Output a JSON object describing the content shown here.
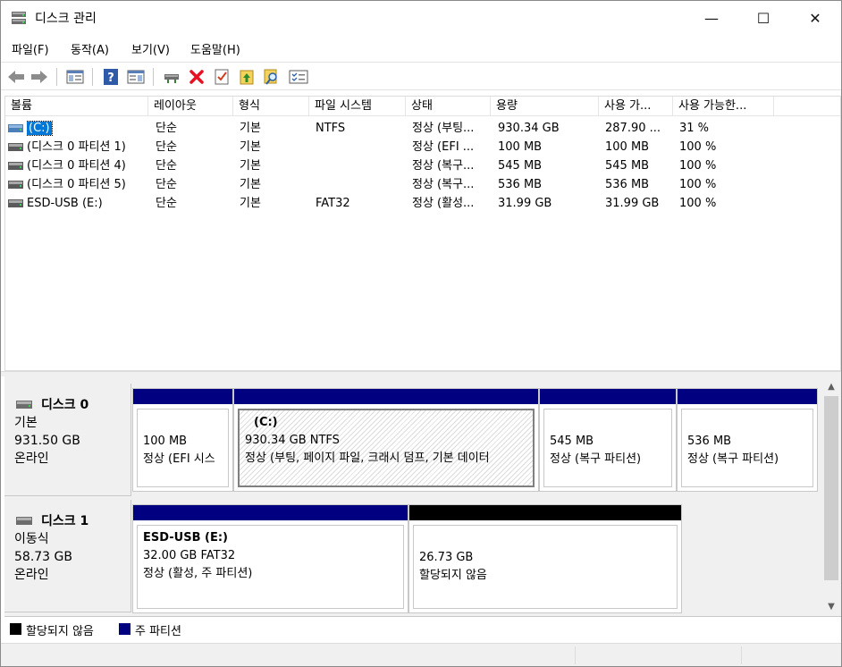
{
  "window": {
    "title": "디스크 관리",
    "controls": {
      "minimize": "—",
      "maximize": "☐",
      "close": "✕"
    }
  },
  "menu": [
    "파일(F)",
    "동작(A)",
    "보기(V)",
    "도움말(H)"
  ],
  "toolbar": {
    "icons": [
      "back-icon",
      "forward-icon",
      "show-hide-console-tree-icon",
      "help-icon",
      "show-hide-action-pane-icon",
      "connect-drive-icon",
      "delete-icon",
      "properties-icon",
      "import-icon",
      "search-icon",
      "rescan-icon"
    ],
    "colors": {
      "delete": "#e81123",
      "arrow": "#8c8c8c"
    }
  },
  "volume_list": {
    "columns": [
      "볼륨",
      "레이아웃",
      "형식",
      "파일 시스템",
      "상태",
      "용량",
      "사용 가...",
      "사용 가능한..."
    ],
    "rows": [
      {
        "volume": "(C:)",
        "layout": "단순",
        "type": "기본",
        "fs": "NTFS",
        "status": "정상 (부팅...",
        "capacity": "930.34 GB",
        "free": "287.90 ...",
        "pct": "31 %",
        "selected": true
      },
      {
        "volume": "(디스크 0 파티션 1)",
        "layout": "단순",
        "type": "기본",
        "fs": "",
        "status": "정상 (EFI ...",
        "capacity": "100 MB",
        "free": "100 MB",
        "pct": "100 %",
        "selected": false
      },
      {
        "volume": "(디스크 0 파티션 4)",
        "layout": "단순",
        "type": "기본",
        "fs": "",
        "status": "정상 (복구...",
        "capacity": "545 MB",
        "free": "545 MB",
        "pct": "100 %",
        "selected": false
      },
      {
        "volume": "(디스크 0 파티션 5)",
        "layout": "단순",
        "type": "기본",
        "fs": "",
        "status": "정상 (복구...",
        "capacity": "536 MB",
        "free": "536 MB",
        "pct": "100 %",
        "selected": false
      },
      {
        "volume": "ESD-USB (E:)",
        "layout": "단순",
        "type": "기본",
        "fs": "FAT32",
        "status": "정상 (활성...",
        "capacity": "31.99 GB",
        "free": "31.99 GB",
        "pct": "100 %",
        "selected": false
      }
    ]
  },
  "disks": [
    {
      "name": "디스크 0",
      "kind": "기본",
      "size": "931.50 GB",
      "state": "온라인",
      "partitions": [
        {
          "title": "",
          "line1": "100 MB",
          "line2": "정상 (EFI 시스",
          "bar": "primary"
        },
        {
          "title": "(C:)",
          "line1": "930.34 GB NTFS",
          "line2": "정상 (부팅, 페이지 파일, 크래시 덤프, 기본 데이터",
          "bar": "primary"
        },
        {
          "title": "",
          "line1": "545 MB",
          "line2": "정상 (복구 파티션)",
          "bar": "primary"
        },
        {
          "title": "",
          "line1": "536 MB",
          "line2": "정상 (복구 파티션)",
          "bar": "primary"
        }
      ]
    },
    {
      "name": "디스크 1",
      "kind": "이동식",
      "size": "58.73 GB",
      "state": "온라인",
      "partitions": [
        {
          "title": "ESD-USB  (E:)",
          "line1": "32.00 GB FAT32",
          "line2": "정상 (활성, 주 파티션)",
          "bar": "primary"
        },
        {
          "title": "",
          "line1": "26.73 GB",
          "line2": "할당되지 않음",
          "bar": "unallocated"
        }
      ]
    }
  ],
  "legend": [
    {
      "label": "할당되지 않음",
      "color": "#000000"
    },
    {
      "label": "주 파티션",
      "color": "#000080"
    }
  ]
}
